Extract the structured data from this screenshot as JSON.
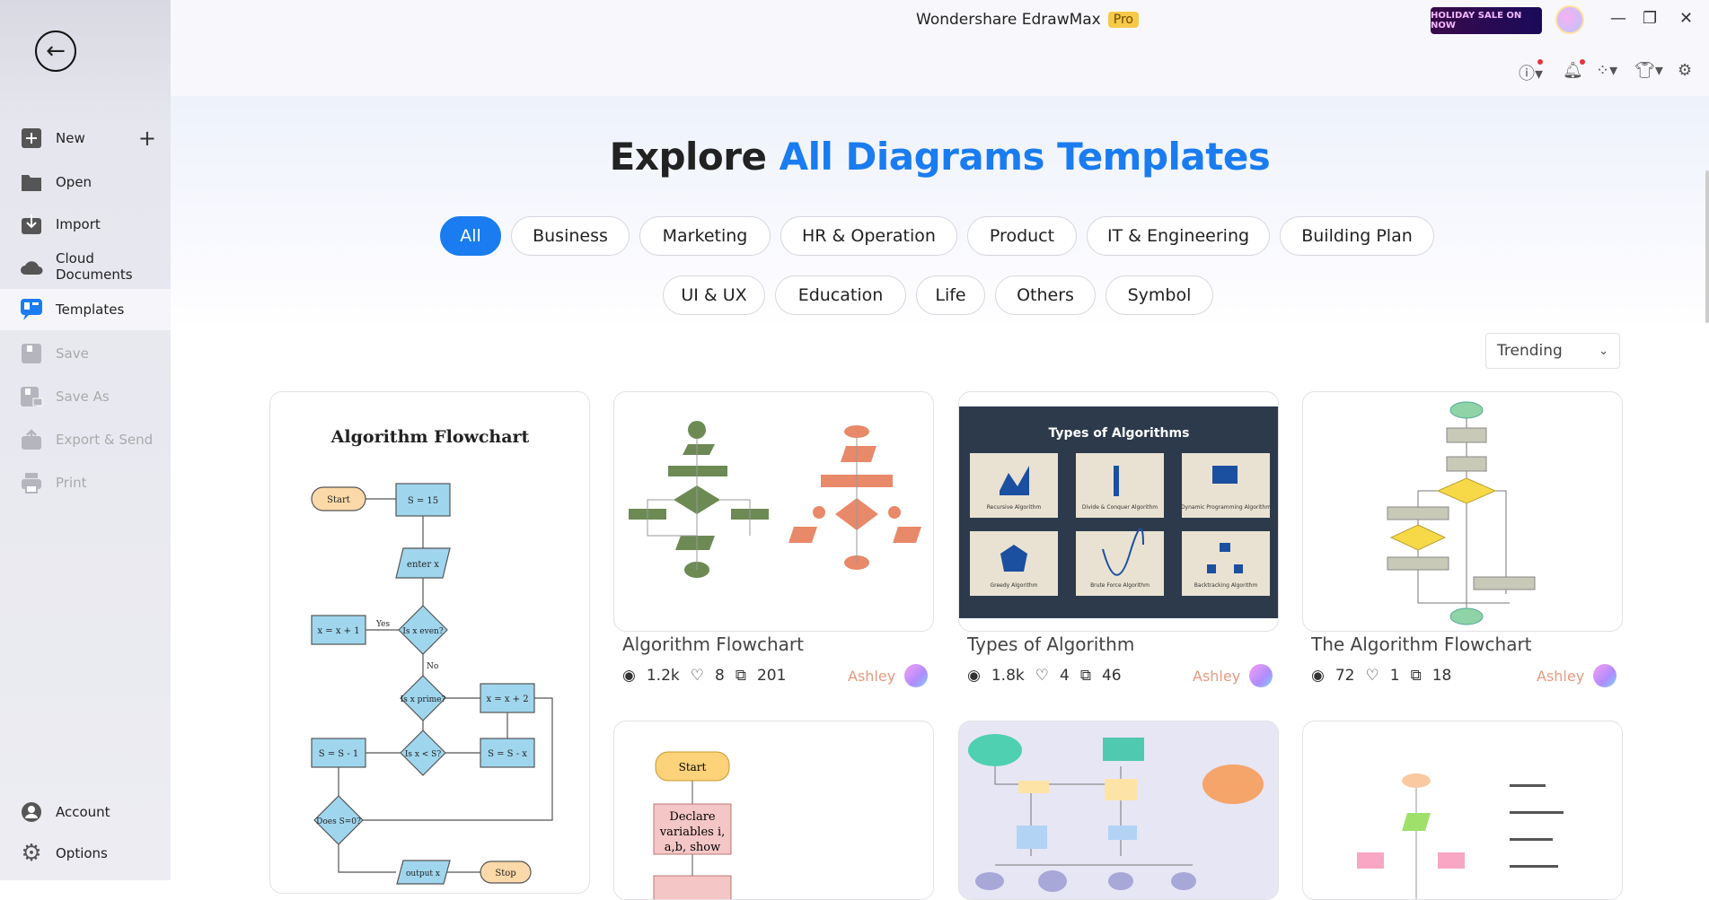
{
  "app": {
    "title": "Wondershare EdrawMax",
    "badge": "Pro",
    "sale_banner": "HOLIDAY SALE ON NOW"
  },
  "sidebar": {
    "items": [
      {
        "label": "New",
        "icon": "plus-square-icon"
      },
      {
        "label": "Open",
        "icon": "folder-icon"
      },
      {
        "label": "Import",
        "icon": "import-icon"
      },
      {
        "label": "Cloud Documents",
        "icon": "cloud-icon"
      },
      {
        "label": "Templates",
        "icon": "templates-icon",
        "active": true
      },
      {
        "label": "Save",
        "icon": "save-icon",
        "disabled": true
      },
      {
        "label": "Save As",
        "icon": "save-as-icon",
        "disabled": true
      },
      {
        "label": "Export & Send",
        "icon": "export-icon",
        "disabled": true
      },
      {
        "label": "Print",
        "icon": "print-icon",
        "disabled": true
      }
    ],
    "bottom": [
      {
        "label": "Account",
        "icon": "account-icon"
      },
      {
        "label": "Options",
        "icon": "gear-icon"
      }
    ]
  },
  "main": {
    "heading_black": "Explore ",
    "heading_blue": "All Diagrams Templates",
    "categories": [
      "All",
      "Business",
      "Marketing",
      "HR & Operation",
      "Product",
      "IT & Engineering",
      "Building Plan",
      "UI & UX",
      "Education",
      "Life",
      "Others",
      "Symbol"
    ],
    "selected_category": "All",
    "sort": "Trending",
    "accent": "#1a7cf0",
    "cards": [
      {
        "title": "Algorithm Flowchart",
        "thumb_title": "Algorithm Flowchart"
      },
      {
        "title": "Algorithm Flowchart",
        "views": "1.2k",
        "likes": "8",
        "copies": "201",
        "author": "Ashley"
      },
      {
        "title": "Types of Algorithm",
        "views": "1.8k",
        "likes": "4",
        "copies": "46",
        "author": "Ashley",
        "thumb_title": "Types of Algorithms",
        "thumb_items": [
          "Recursive Algorithm",
          "Divide & Conquer Algorithm",
          "Dynamic Programming Algorithm",
          "Greedy Algorithm",
          "Brute Force Algorithm",
          "Backtracking Algorithm"
        ]
      },
      {
        "title": "The Algorithm Flowchart",
        "views": "72",
        "likes": "1",
        "copies": "18",
        "author": "Ashley"
      }
    ],
    "flow": {
      "start": "Start",
      "s15": "S = 15",
      "enter": "enter x",
      "even": "Is x even?",
      "xp1": "x = x + 1",
      "yes": "Yes",
      "no": "No",
      "prime": "Is x prime?",
      "xp2": "x = x + 2",
      "lt": "Is x < S?",
      "sm1": "S = S - 1",
      "smx": "S = S - x",
      "does": "Does S=0?",
      "output": "output x",
      "stop": "Stop",
      "declare1": "Declare",
      "declare2": "variables i,",
      "declare3": "a,b, show"
    }
  }
}
